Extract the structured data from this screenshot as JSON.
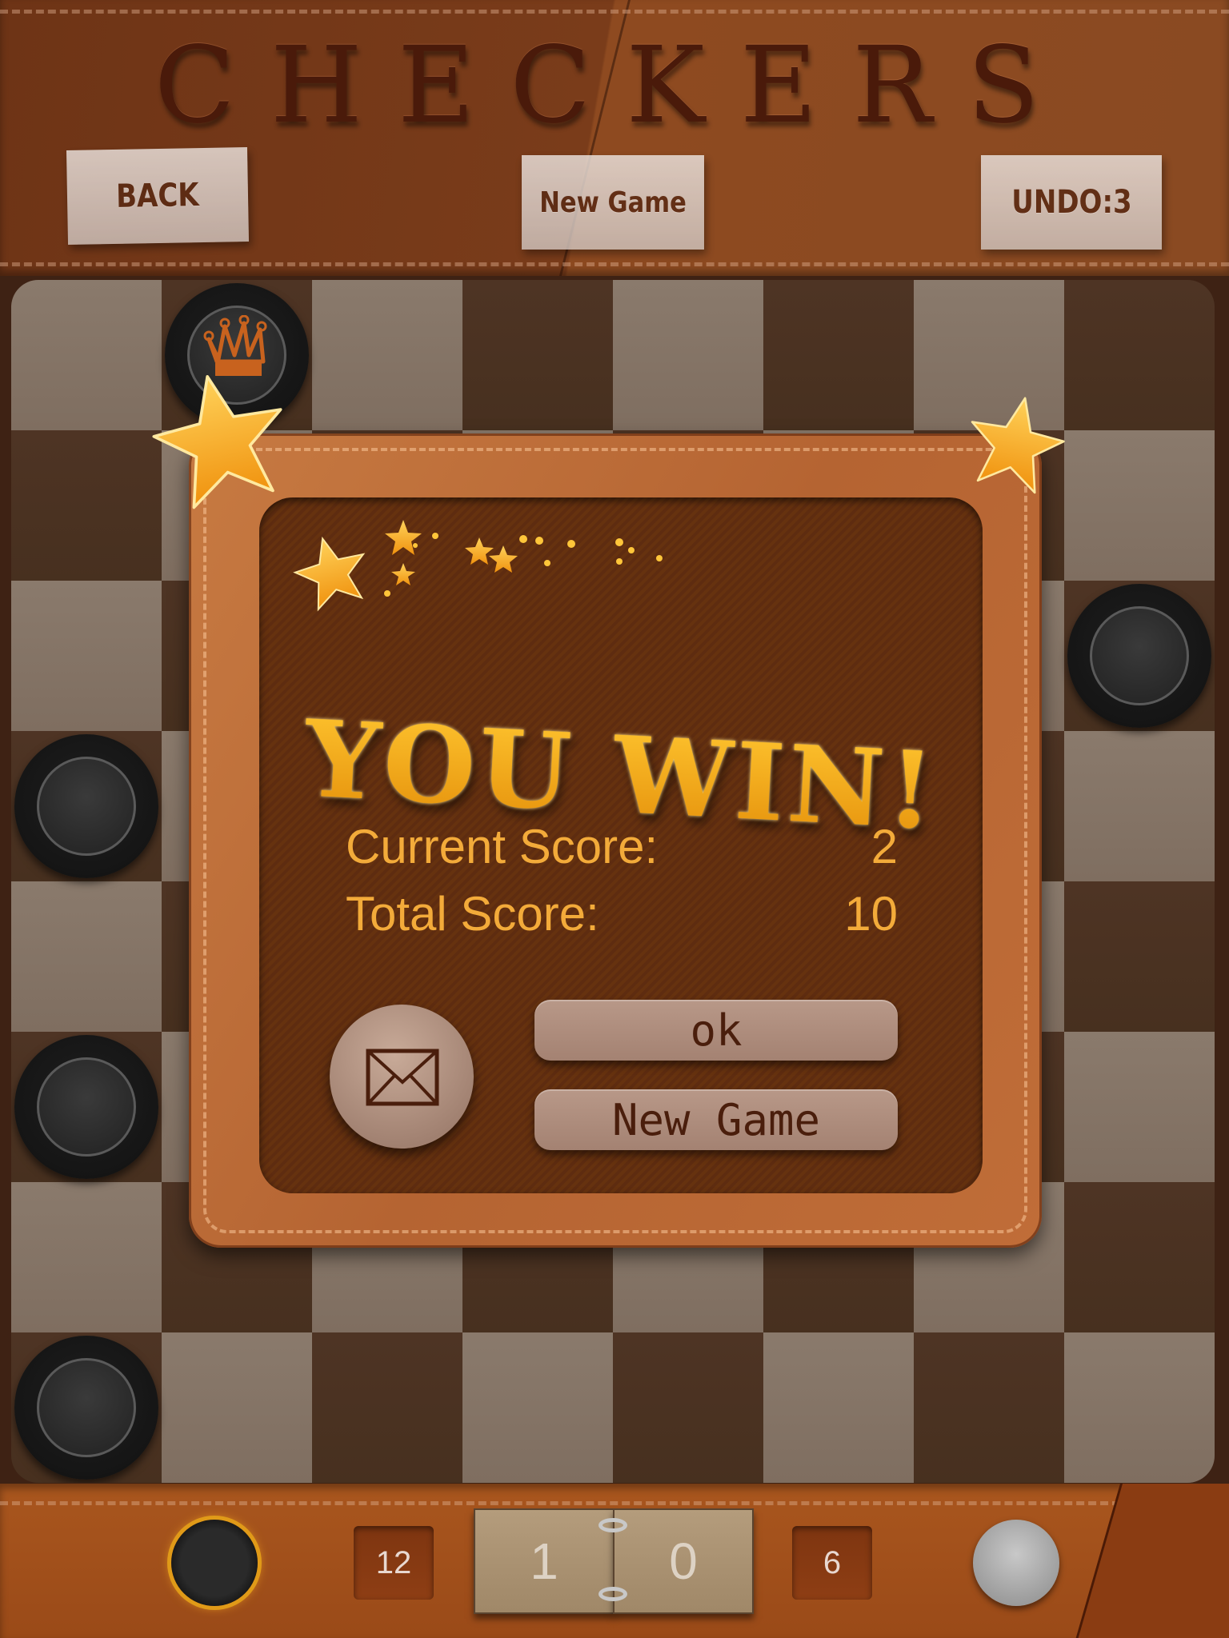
{
  "header": {
    "title": "CHECKERS",
    "back_label": "BACK",
    "new_game_label": "New Game",
    "undo_label": "UNDO:3"
  },
  "board": {
    "size": 8,
    "top_left_tile": "light",
    "pieces": [
      {
        "row": 0,
        "col": 1,
        "color": "black",
        "king": true
      },
      {
        "row": 2,
        "col": 7,
        "color": "black",
        "king": false
      },
      {
        "row": 3,
        "col": 0,
        "color": "black",
        "king": false
      },
      {
        "row": 5,
        "col": 0,
        "color": "black",
        "king": false
      },
      {
        "row": 7,
        "col": 0,
        "color": "black",
        "king": false
      }
    ]
  },
  "dialog": {
    "title": "YOU WIN!",
    "scores": [
      {
        "label": "Current Score:",
        "value": "2"
      },
      {
        "label": "Total Score:",
        "value": "10"
      }
    ],
    "mail_icon": "envelope-icon",
    "ok_label": "ok",
    "new_game_label": "New Game"
  },
  "footer": {
    "black_count": "12",
    "score_left": "1",
    "score_right": "0",
    "white_count": "6",
    "active_player": "black"
  },
  "colors": {
    "accent_gold": "#f5ad1c",
    "score_text": "#f3ab3a",
    "leather": "#b56432",
    "board_light": "#8a7a6c",
    "board_dark": "#4e3424"
  }
}
